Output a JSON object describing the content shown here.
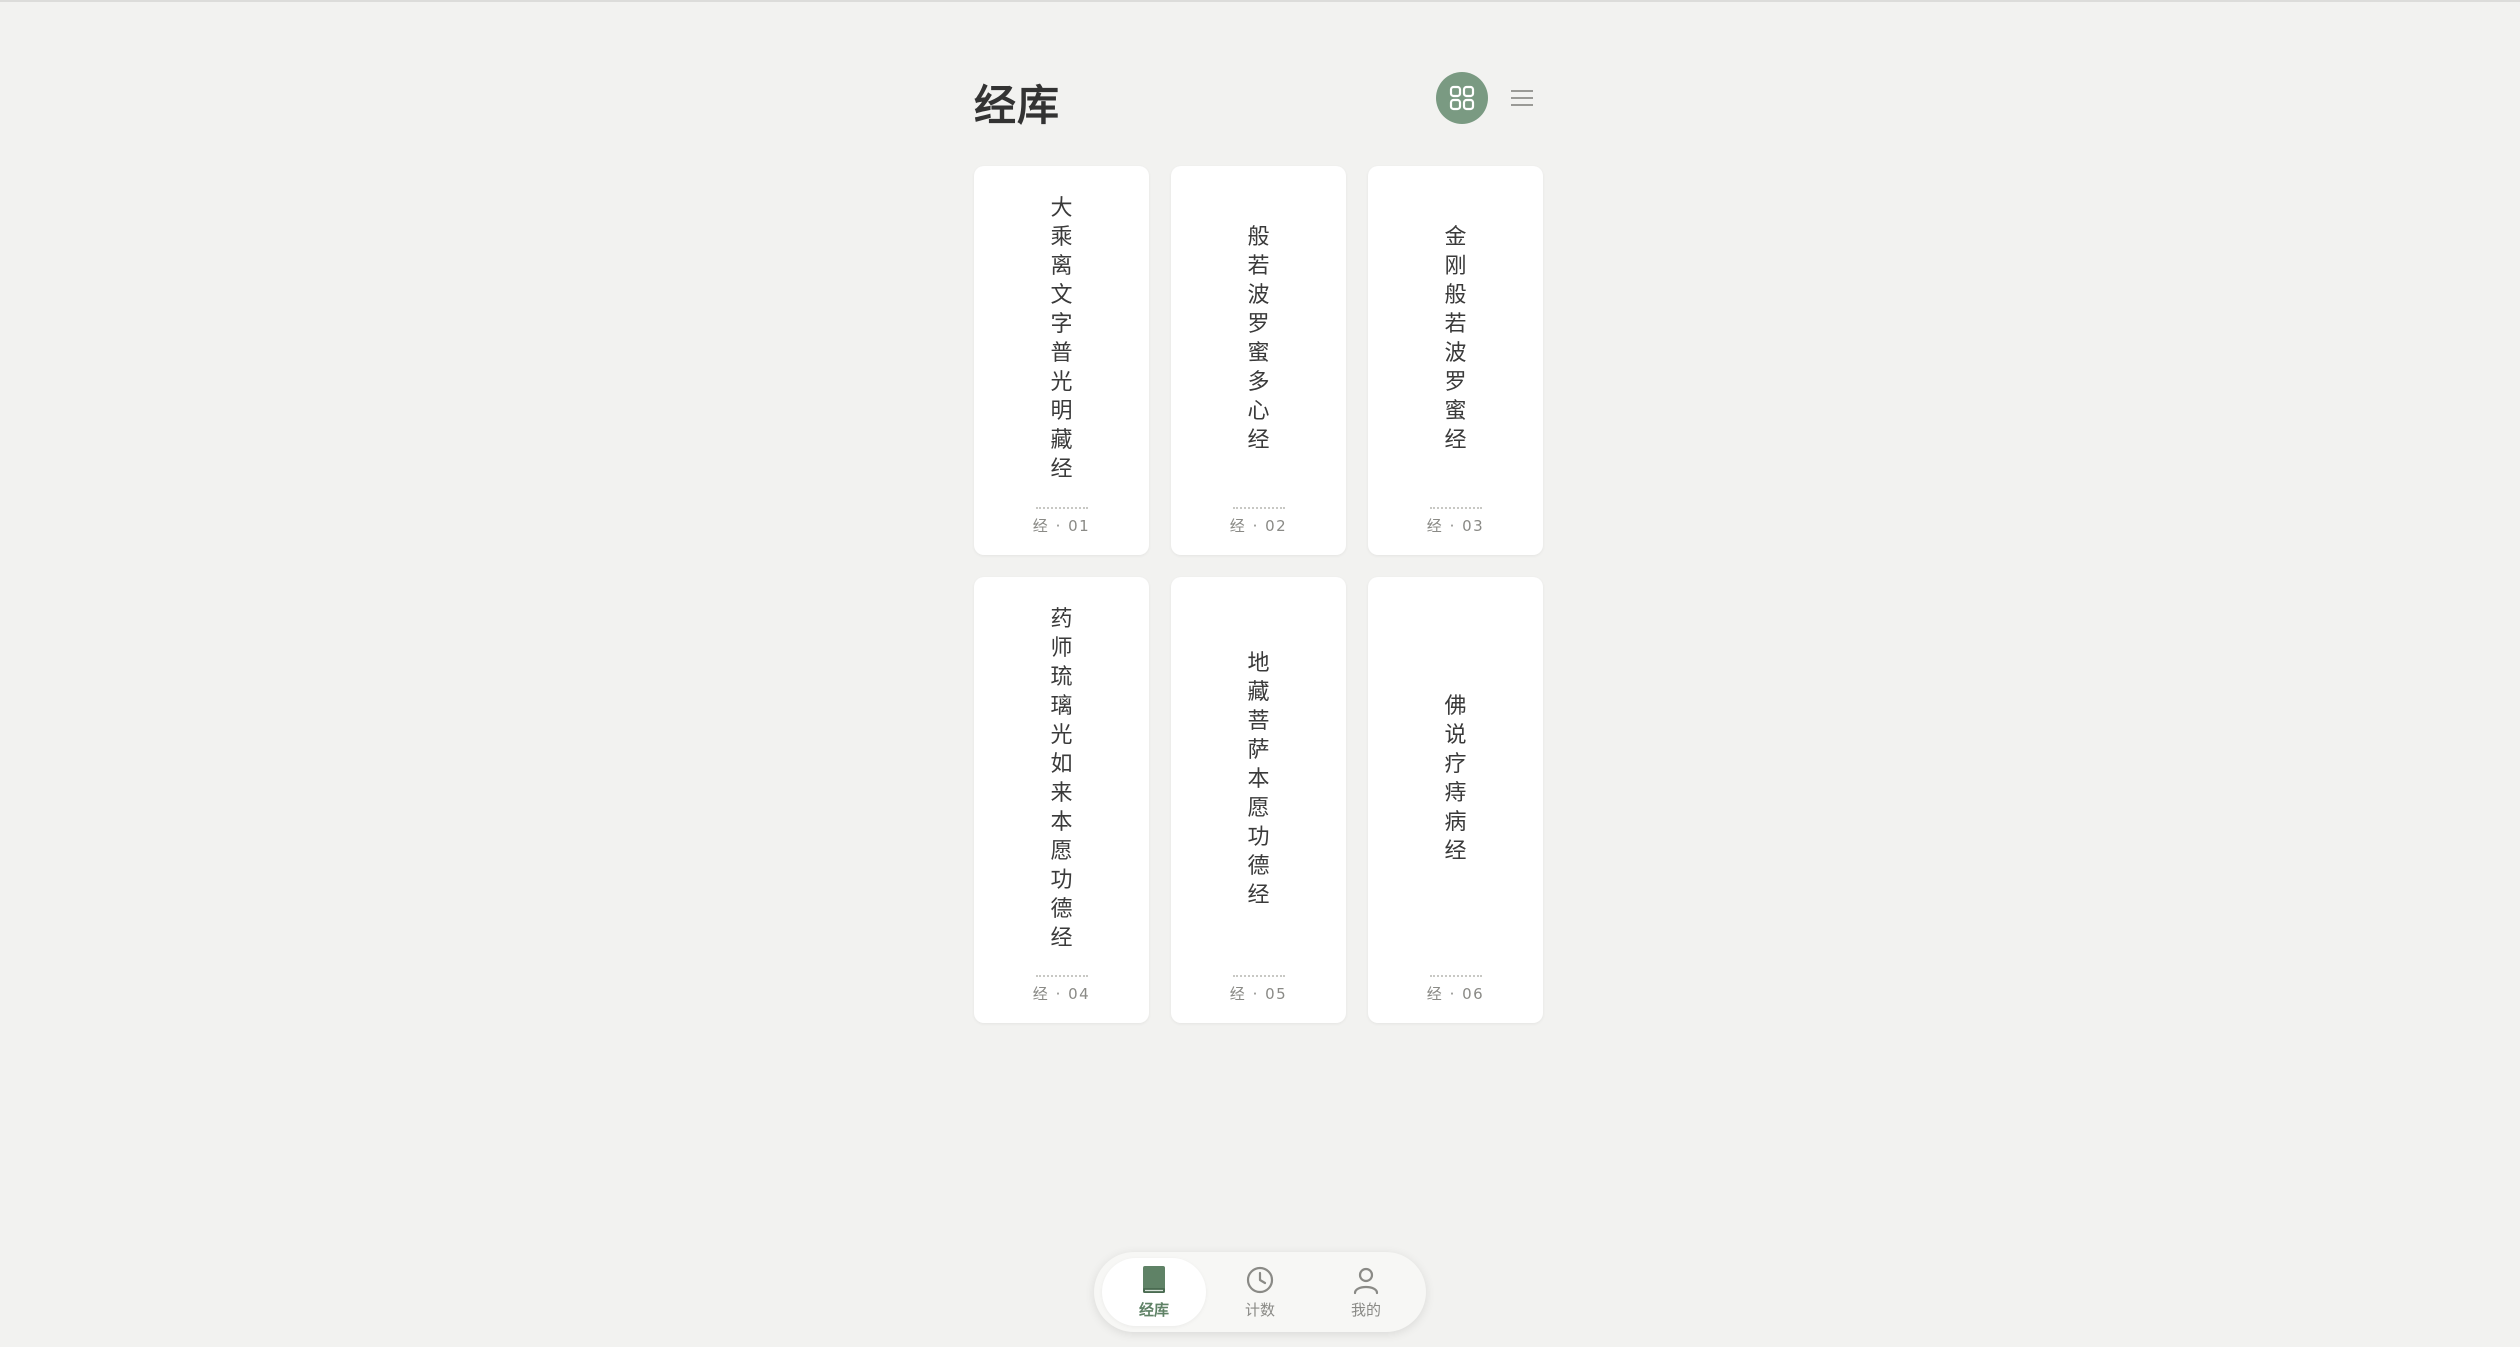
{
  "header": {
    "title": "经库"
  },
  "colors": {
    "accent": "#7a9a82",
    "background": "#f2f2f0",
    "card": "#ffffff"
  },
  "sutras": [
    {
      "title": "大乘离文字普光明藏经",
      "number": "经 · 01"
    },
    {
      "title": "般若波罗蜜多心经",
      "number": "经 · 02"
    },
    {
      "title": "金刚般若波罗蜜经",
      "number": "经 · 03"
    },
    {
      "title": "药师琉璃光如来本愿功德经",
      "number": "经 · 04"
    },
    {
      "title": "地藏菩萨本愿功德经",
      "number": "经 · 05"
    },
    {
      "title": "佛说疗痔病经",
      "number": "经 · 06"
    }
  ],
  "tabbar": {
    "tabs": [
      {
        "label": "经库",
        "icon": "book-icon",
        "active": true
      },
      {
        "label": "计数",
        "icon": "clock-icon",
        "active": false
      },
      {
        "label": "我的",
        "icon": "user-icon",
        "active": false
      }
    ]
  }
}
